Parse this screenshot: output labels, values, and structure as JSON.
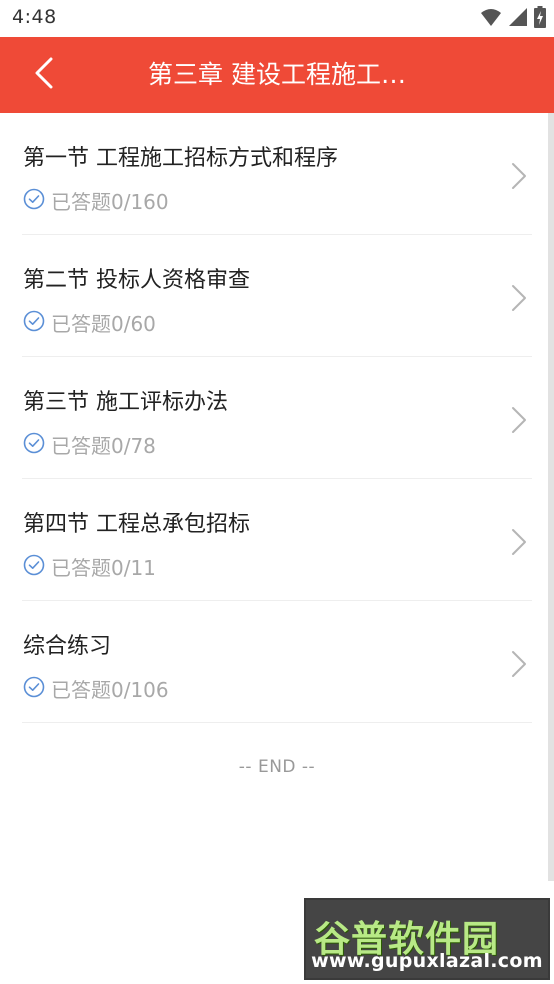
{
  "status_bar": {
    "time": "4:48",
    "icons": [
      "wifi-icon",
      "signal-icon",
      "battery-icon"
    ]
  },
  "app_bar": {
    "title": "第三章 建设工程施工…",
    "back_icon": "chevron-left-icon",
    "color": "#ef4a37"
  },
  "sections": [
    {
      "title": "第一节 工程施工招标方式和程序",
      "progress": "已答题0/160"
    },
    {
      "title": "第二节 投标人资格审查",
      "progress": "已答题0/60"
    },
    {
      "title": "第三节 施工评标办法",
      "progress": "已答题0/78"
    },
    {
      "title": "第四节 工程总承包招标",
      "progress": "已答题0/11"
    },
    {
      "title": "综合练习",
      "progress": "已答题0/106"
    }
  ],
  "end_text": "-- END --",
  "watermark": {
    "logo": "谷普软件园",
    "url": "www.gupuxlazal.com"
  }
}
